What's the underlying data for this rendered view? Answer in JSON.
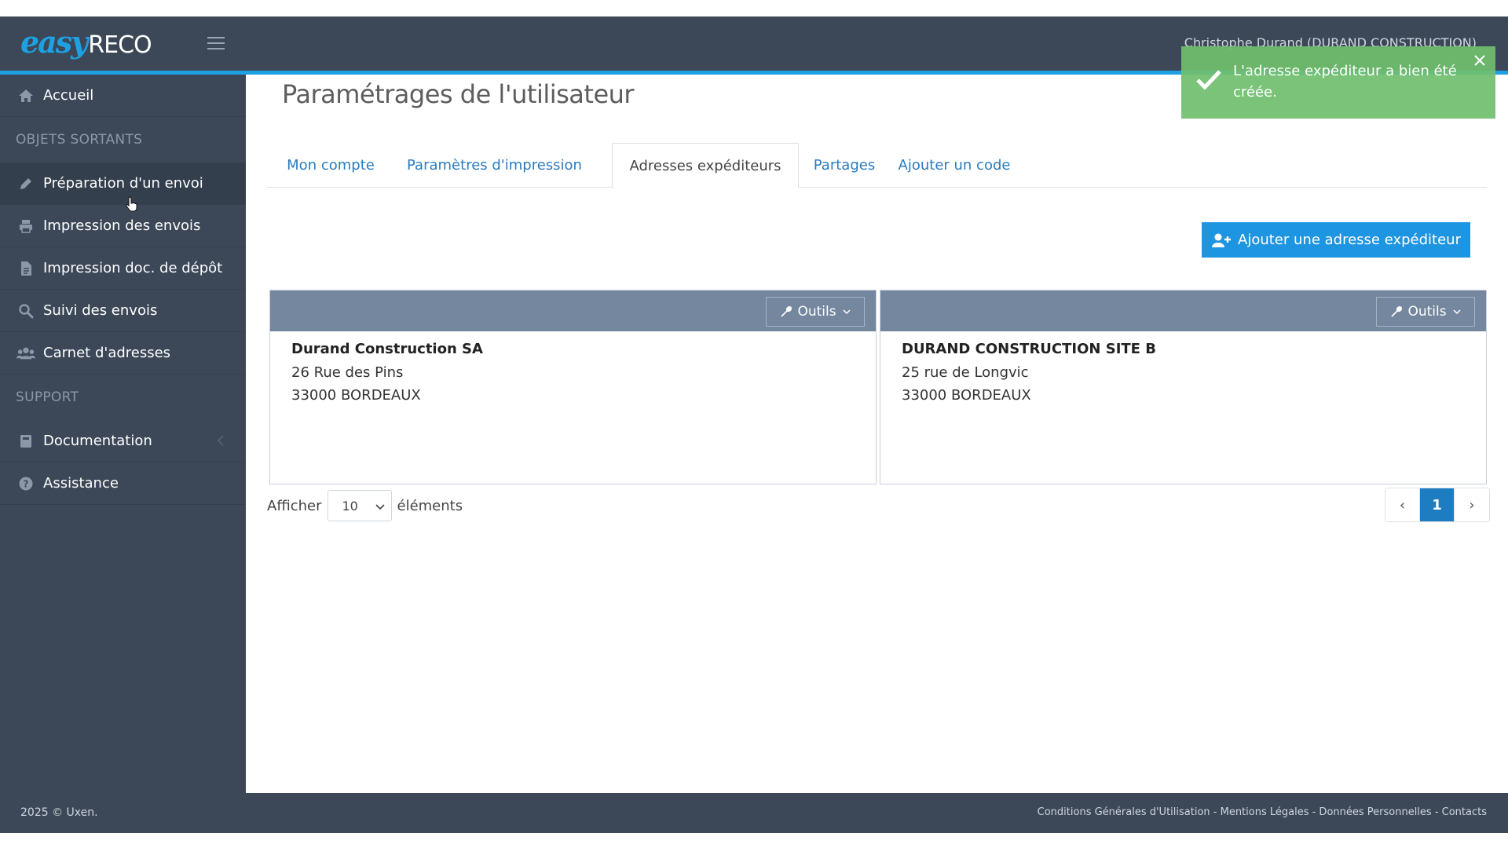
{
  "header": {
    "logo_easy": "easy",
    "logo_reco": "RECO",
    "user_name": "Christophe Durand (DURAND CONSTRUCTION)"
  },
  "sidebar": {
    "items": [
      {
        "label": "Accueil",
        "icon": "home-icon"
      },
      {
        "section": "OBJETS SORTANTS"
      },
      {
        "label": "Préparation d'un envoi",
        "icon": "pencil-icon"
      },
      {
        "label": "Impression des envois",
        "icon": "printer-icon"
      },
      {
        "label": "Impression doc. de dépôt",
        "icon": "document-icon"
      },
      {
        "label": "Suivi des envois",
        "icon": "search-icon"
      },
      {
        "label": "Carnet d'adresses",
        "icon": "users-icon"
      },
      {
        "section": "SUPPORT"
      },
      {
        "label": "Documentation",
        "icon": "book-icon"
      },
      {
        "label": "Assistance",
        "icon": "help-icon"
      }
    ]
  },
  "main": {
    "title": "Paramétrages de l'utilisateur",
    "tabs": [
      {
        "label": "Mon compte"
      },
      {
        "label": "Paramètres d'impression"
      },
      {
        "label": "Adresses expéditeurs",
        "active": true
      },
      {
        "label": "Partages"
      },
      {
        "label": "Ajouter un code"
      }
    ],
    "add_button": "Ajouter une adresse expéditeur",
    "tools_label": "Outils",
    "cards": [
      {
        "name": "Durand Construction SA",
        "street": "26 Rue des Pins",
        "city": "33000 BORDEAUX"
      },
      {
        "name": "DURAND CONSTRUCTION SITE B",
        "street": "25 rue de Longvic",
        "city": "33000 BORDEAUX"
      }
    ],
    "show_label": "Afficher",
    "page_size": "10",
    "elements_label": "éléments",
    "pager": {
      "prev": "‹",
      "current": "1",
      "next": "›"
    }
  },
  "toast": {
    "message": "L'adresse expéditeur a bien été créée."
  },
  "footer": {
    "copyright": "2025 © Uxen.",
    "links": "Conditions Générales d'Utilisation - Mentions Légales - Données Personnelles - Contacts"
  },
  "colors": {
    "header_bg": "#3c4858",
    "accent": "#1ea1e3",
    "button_blue": "#1e95e0",
    "card_head": "#74879f",
    "toast_green": "#70be6e"
  }
}
